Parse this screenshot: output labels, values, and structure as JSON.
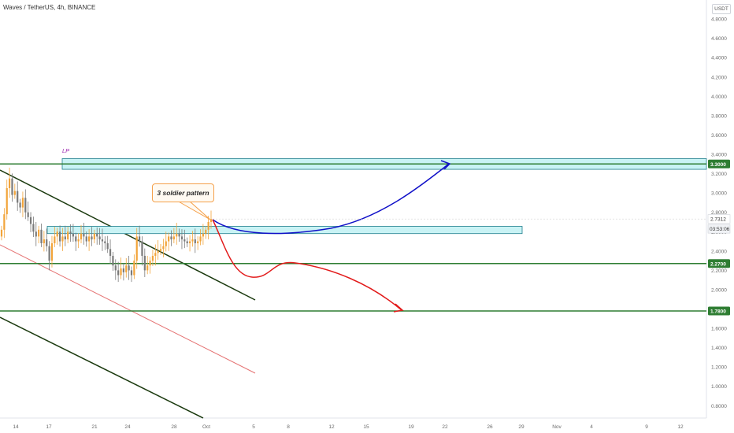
{
  "header": {
    "title": "Waves / TetherUS, 4h, BINANCE",
    "currency": "USDT"
  },
  "annotations": {
    "lp_label": "LP",
    "pattern_label": "3 soldier pattern"
  },
  "colors": {
    "support_line": "#2e7d32",
    "channel_line": "#1b3a0f",
    "pink_line": "#e57373",
    "zone_fill": "#c9f3f5",
    "zone_border": "#1e7d8c",
    "bull_arrow": "#1010c8",
    "bear_arrow": "#e21b1b",
    "candle_up": "#f2a43a",
    "candle_down": "#7a7a7a",
    "level_badge": "#2e7d32"
  },
  "chart_data": {
    "type": "candlestick",
    "symbol": "Waves / TetherUS",
    "timeframe": "4h",
    "exchange": "BINANCE",
    "y_axis": {
      "unit": "USDT",
      "ylim": [
        0.65,
        5.0
      ],
      "ticks": [
        "4.8000",
        "4.6000",
        "4.4000",
        "4.2000",
        "4.0000",
        "3.8000",
        "3.6000",
        "3.4000",
        "3.2000",
        "3.0000",
        "2.8000",
        "2.6000",
        "2.4000",
        "2.2000",
        "2.0000",
        "1.8000",
        "1.6000",
        "1.4000",
        "1.2000",
        "1.0000",
        "0.8000"
      ]
    },
    "x_axis": {
      "ticks": [
        "14",
        "17",
        "21",
        "24",
        "28",
        "Oct",
        "5",
        "8",
        "12",
        "15",
        "19",
        "22",
        "26",
        "29",
        "Nov",
        "4",
        "9",
        "12"
      ]
    },
    "horizontal_levels": [
      {
        "label": "3.3000",
        "value": 3.3
      },
      {
        "label": "2.2700",
        "value": 2.27
      },
      {
        "label": "1.7800",
        "value": 1.78
      }
    ],
    "current_price": {
      "label": "2.7312",
      "value": 2.7312,
      "countdown": "03:53:06"
    },
    "zones": [
      {
        "name": "upper-zone",
        "y_top": 3.355,
        "y_bottom": 3.245,
        "x_start": "15",
        "x_end": "29+"
      },
      {
        "name": "middle-zone",
        "y_top": 2.655,
        "y_bottom": 2.58,
        "x_start": "16",
        "x_end": "29"
      }
    ],
    "candles_close": [
      2.62,
      2.78,
      3.05,
      3.15,
      2.98,
      3.02,
      2.9,
      2.85,
      2.95,
      2.8,
      2.75,
      2.68,
      2.6,
      2.55,
      2.62,
      2.48,
      2.52,
      2.45,
      2.3,
      2.48,
      2.55,
      2.6,
      2.5,
      2.55,
      2.52,
      2.6,
      2.58,
      2.55,
      2.5,
      2.52,
      2.58,
      2.55,
      2.5,
      2.55,
      2.52,
      2.58,
      2.55,
      2.52,
      2.5,
      2.48,
      2.42,
      2.35,
      2.25,
      2.2,
      2.15,
      2.22,
      2.18,
      2.25,
      2.2,
      2.15,
      2.3,
      2.55,
      2.5,
      2.35,
      2.2,
      2.25,
      2.3,
      2.35,
      2.38,
      2.4,
      2.42,
      2.45,
      2.5,
      2.55,
      2.52,
      2.55,
      2.58,
      2.55,
      2.52,
      2.5,
      2.48,
      2.5,
      2.52,
      2.48,
      2.5,
      2.55,
      2.58,
      2.62,
      2.7,
      2.73
    ]
  }
}
